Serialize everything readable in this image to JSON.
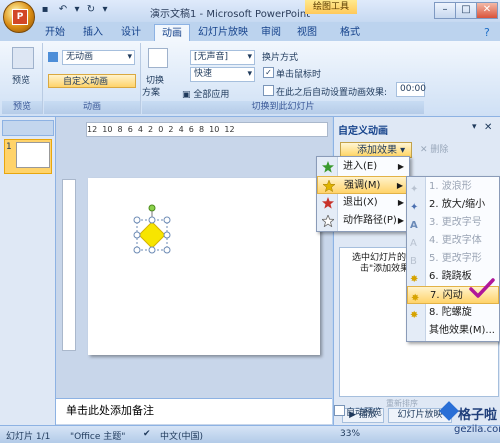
{
  "title_bar": {
    "title": "演示文稿1 - Microsoft PowerPoint",
    "context_tab": "绘图工具"
  },
  "tabs": [
    "开始",
    "插入",
    "设计",
    "动画",
    "幻灯片放映",
    "审阅",
    "视图",
    "格式"
  ],
  "active_tab": "动画",
  "ribbon": {
    "preview": {
      "label": "预览",
      "group": "预览"
    },
    "animation_group": {
      "dropdown_value": "无动画",
      "custom_button": "自定义动画",
      "group": "动画"
    },
    "transition": {
      "scheme_label_1": "切换",
      "scheme_label_2": "方案",
      "sound_value": "[无声音]",
      "speed_value": "快速",
      "apply_all": "全部应用",
      "advance_heading": "换片方式",
      "on_click": "单击鼠标时",
      "auto_after": "在此之后自动设置动画效果:",
      "time_value": "00:00",
      "group": "切换到此幻灯片"
    }
  },
  "slide_pane": {
    "slide_number": "1"
  },
  "ruler_text": "12  10  8  6  4  2  0  2  4  6  8  10  12",
  "task_pane": {
    "title": "自定义动画",
    "add_effect": "添加效果",
    "remove": "删除",
    "hint_line1": "选中幻灯片的某",
    "hint_line2": "击\"添加效果\"",
    "reorder": "重新排序",
    "play": "播放",
    "slideshow": "幻灯片放映",
    "autopreview": "自动预览"
  },
  "menu_main": [
    {
      "label": "进入(E)",
      "icon": "green-star-icon",
      "color": "#3a9a2e"
    },
    {
      "label": "强调(M)",
      "icon": "yellow-star-icon",
      "color": "#e0b400",
      "highlighted": true
    },
    {
      "label": "退出(X)",
      "icon": "red-star-icon",
      "color": "#c8322a"
    },
    {
      "label": "动作路径(P)",
      "icon": "outline-star-icon",
      "color": "#666666"
    }
  ],
  "menu_emphasis": [
    {
      "label": "1. 波浪形",
      "disabled": true
    },
    {
      "label": "2. 放大/缩小",
      "disabled": false
    },
    {
      "label": "3. 更改字号",
      "disabled": true
    },
    {
      "label": "4. 更改字体",
      "disabled": true
    },
    {
      "label": "5. 更改字形",
      "disabled": true
    },
    {
      "label": "6. 跷跷板",
      "disabled": false
    },
    {
      "label": "7. 闪动",
      "disabled": false,
      "highlighted": true
    },
    {
      "label": "8. 陀螺旋",
      "disabled": false
    },
    {
      "label": "其他效果(M)...",
      "disabled": false
    }
  ],
  "notes": "单击此处添加备注",
  "status_bar": {
    "slide": "幻灯片 1/1",
    "theme": "\"Office 主题\"",
    "language": "中文(中国)",
    "zoom": "33%"
  },
  "watermark": {
    "text": "格子啦",
    "url": "gezila.com"
  },
  "colors": {
    "accent": "#ffd36a",
    "ribbon_bg": "#dfeafb",
    "checkmark": "#b0179a"
  }
}
